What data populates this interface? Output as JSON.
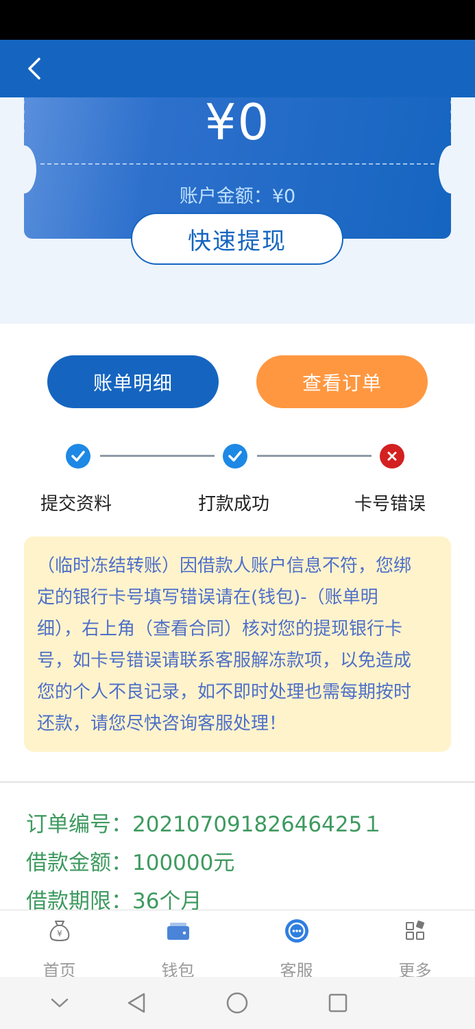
{
  "card": {
    "amount": "¥0",
    "balance_label": "账户金额：",
    "balance_value": "¥0",
    "withdraw_label": "快速提现"
  },
  "actions": {
    "bill_detail": "账单明细",
    "view_order": "查看订单"
  },
  "steps": [
    {
      "label": "提交资料",
      "status": "done"
    },
    {
      "label": "打款成功",
      "status": "done"
    },
    {
      "label": "卡号错误",
      "status": "error"
    }
  ],
  "notice": {
    "lines": [
      "（临时冻结转账）因借款人账户信息不符，您绑",
      "定的银行卡号填写错误请在(钱包)-（账单明",
      "细），右上角（查看合同）核对您的提现银行卡",
      "号，如卡号错误请联系客服解冻款项，以免造成",
      "您的个人不良记录，如不即时处理也需每期按时",
      "还款，请您尽快咨询客服处理！"
    ]
  },
  "order": {
    "number_label": "订单编号：",
    "number_value": "20210709182646425１",
    "amount_label": "借款金额：",
    "amount_value": "100000元",
    "term_label": "借款期限：",
    "term_value": "36个月"
  },
  "tabbar": [
    {
      "label": "首页",
      "icon": "money-bag-icon"
    },
    {
      "label": "钱包",
      "icon": "wallet-icon"
    },
    {
      "label": "客服",
      "icon": "chat-icon"
    },
    {
      "label": "更多",
      "icon": "grid-icon"
    }
  ],
  "colors": {
    "primary": "#1565c0",
    "accent_orange": "#ff9740",
    "success_text": "#3e9a5f",
    "notice_bg": "#fff3cc",
    "notice_text": "#4f70c8",
    "error": "#d32020"
  }
}
